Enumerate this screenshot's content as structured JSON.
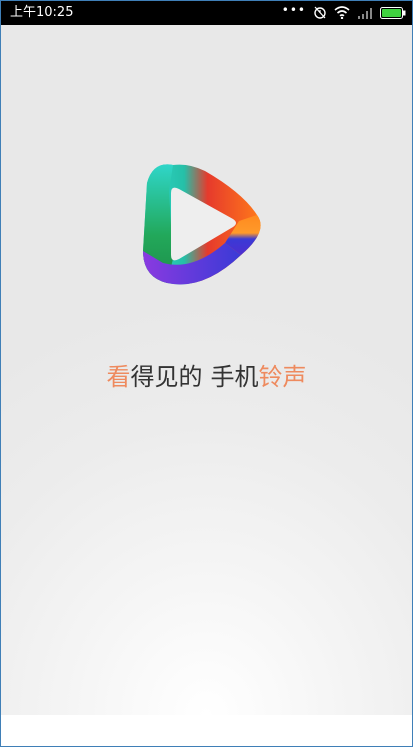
{
  "status_bar": {
    "time": "上午10:25",
    "icons": [
      "more-dots-icon",
      "alarm-icon",
      "wifi-icon",
      "signal-icon",
      "battery-icon"
    ]
  },
  "splash": {
    "tagline": {
      "part1_accent": "看",
      "part2": "得见的",
      "part3": "手机",
      "part4_accent": "铃声"
    }
  },
  "colors": {
    "accent": "#ee8a5e",
    "text": "#333333",
    "status_bar_bg": "#000000",
    "logo_colors": [
      "#2fd6c9",
      "#22a85a",
      "#e63a2c",
      "#ff8a1f",
      "#3a3ad6",
      "#8a3ae0"
    ]
  }
}
